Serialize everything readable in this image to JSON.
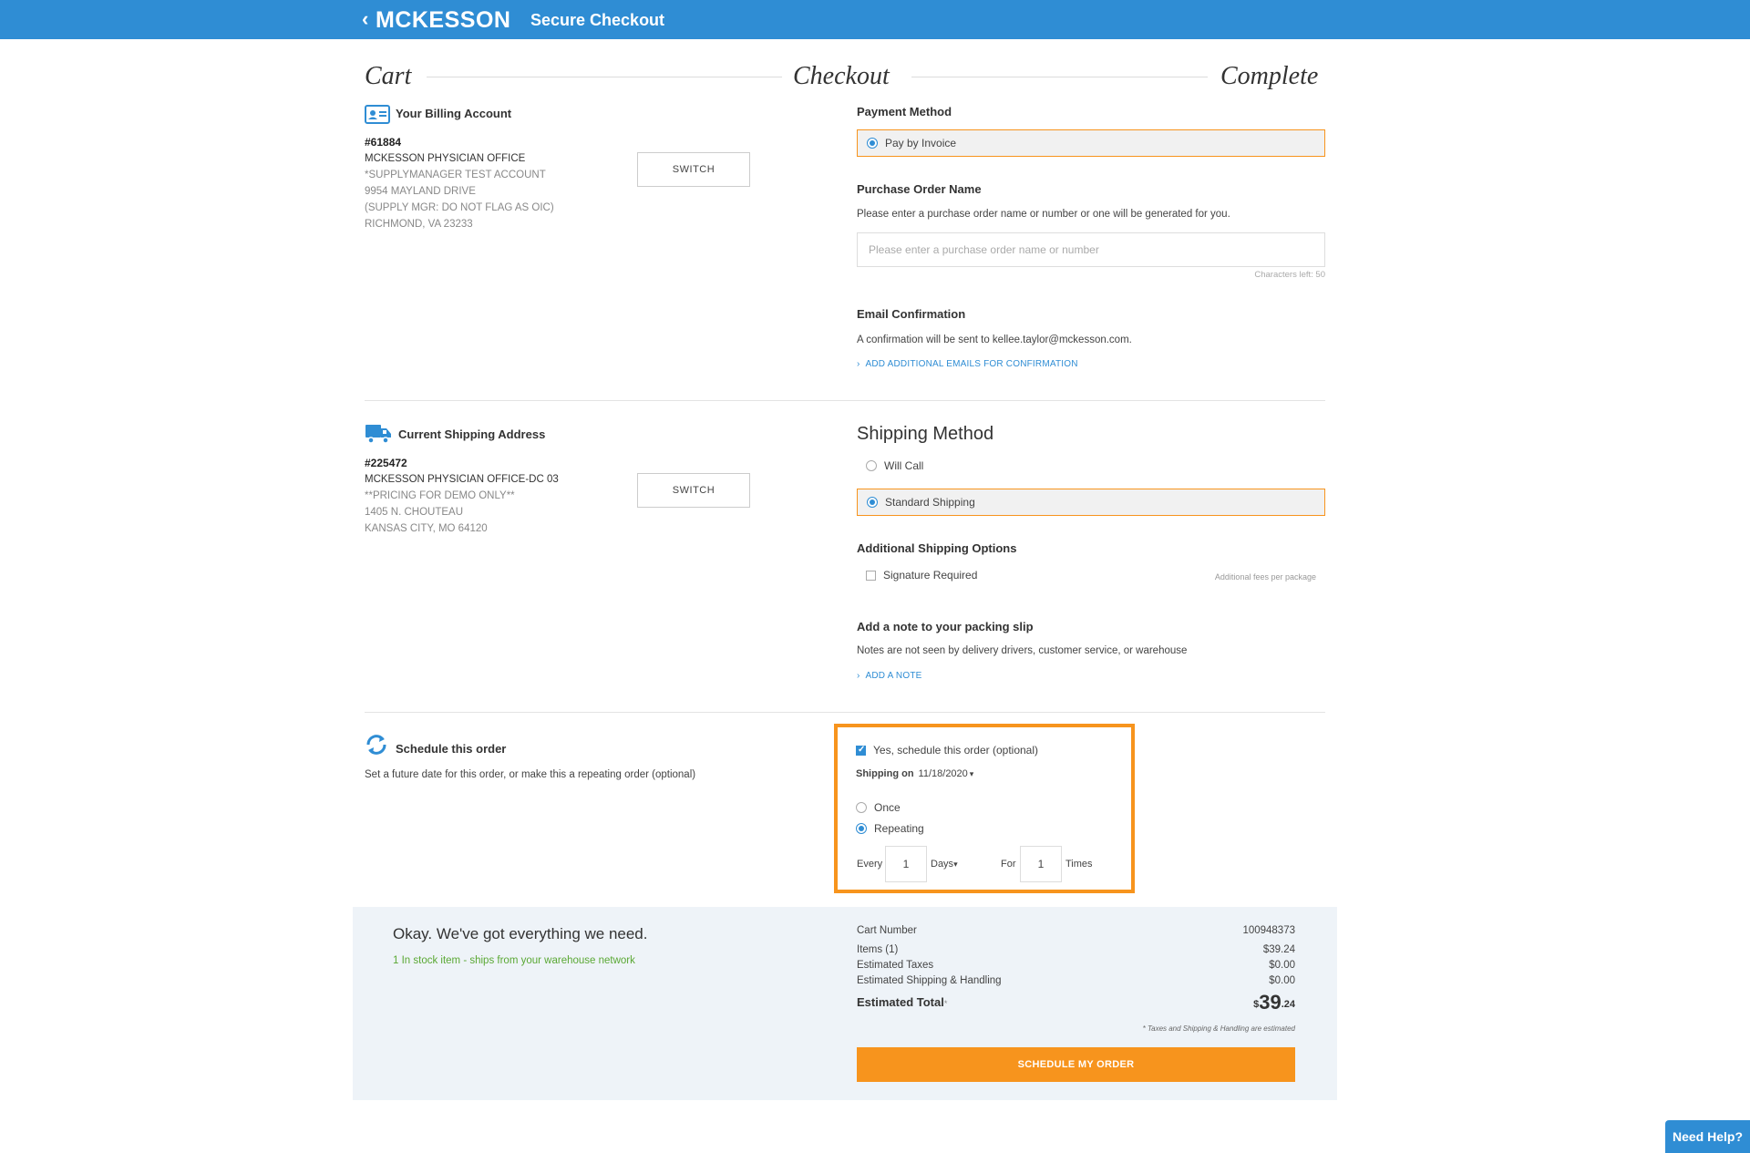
{
  "header": {
    "back_icon": "chevron-left-icon",
    "logo": "MCKESSON",
    "title": "Secure Checkout",
    "bg_color": "#2f8dd4"
  },
  "steps": {
    "cart": "Cart",
    "checkout": "Checkout",
    "complete": "Complete"
  },
  "billing": {
    "icon": "id-card-icon",
    "title": "Your Billing Account",
    "number": "#61884",
    "lines": [
      "MCKESSON PHYSICIAN OFFICE",
      "*SUPPLYMANAGER TEST ACCOUNT",
      "9954 MAYLAND DRIVE",
      "(SUPPLY MGR: DO NOT FLAG AS OIC)",
      "RICHMOND, VA 23233"
    ],
    "switch_label": "SWITCH"
  },
  "payment": {
    "title": "Payment Method",
    "selected_option": "Pay by Invoice"
  },
  "purchase_order": {
    "title": "Purchase Order Name",
    "help": "Please enter a purchase order name or number or one will be generated for you.",
    "placeholder": "Please enter a purchase order name or number",
    "value": "",
    "chars_left": "Characters left: 50"
  },
  "email": {
    "title": "Email Confirmation",
    "text": "A confirmation will be sent to kellee.taylor@mckesson.com.",
    "link": "ADD ADDITIONAL EMAILS FOR CONFIRMATION"
  },
  "shipping_address": {
    "icon": "truck-icon",
    "title": "Current Shipping Address",
    "number": "#225472",
    "lines": [
      "MCKESSON PHYSICIAN OFFICE-DC 03",
      "**PRICING FOR DEMO ONLY**",
      "1405 N. CHOUTEAU",
      "KANSAS CITY, MO 64120"
    ],
    "switch_label": "SWITCH"
  },
  "shipping_method": {
    "title": "Shipping Method",
    "options": [
      "Will Call",
      "Standard Shipping"
    ],
    "selected": "Standard Shipping"
  },
  "additional_shipping": {
    "title": "Additional Shipping Options",
    "signature_label": "Signature Required",
    "signature_checked": false,
    "fee_note": "Additional fees per package"
  },
  "packing_slip": {
    "title": "Add a note to your packing slip",
    "text": "Notes are not seen by delivery drivers, customer service, or warehouse",
    "link": "ADD A NOTE"
  },
  "schedule": {
    "icon": "refresh-icon",
    "title": "Schedule this order",
    "subtitle": "Set a future date for this order, or make this a repeating order (optional)",
    "yes_label": "Yes, schedule this order (optional)",
    "yes_checked": true,
    "shipping_on_label": "Shipping on",
    "shipping_on_value": "11/18/2020",
    "once_label": "Once",
    "repeating_label": "Repeating",
    "selected": "Repeating",
    "every_label": "Every",
    "every_value": "1",
    "unit_value": "Days",
    "for_label": "For",
    "for_value": "1",
    "times_label": "Times"
  },
  "summary": {
    "heading": "Okay. We've got everything we need.",
    "stock_note": "1 In stock item - ships from your warehouse network",
    "rows": [
      {
        "label": "Cart Number",
        "value": "100948373"
      },
      {
        "label": "Items (1)",
        "value": "$39.24"
      },
      {
        "label": "Estimated Taxes",
        "value": "$0.00"
      },
      {
        "label": "Estimated Shipping & Handling",
        "value": "$0.00"
      }
    ],
    "total_label": "Estimated Total",
    "total_marker": "*",
    "total_currency": "$",
    "total_dollars": "39",
    "total_cents": ".24",
    "footnote": "* Taxes and Shipping & Handling are estimated",
    "cta": "SCHEDULE MY ORDER"
  },
  "help": {
    "label": "Need Help?"
  },
  "colors": {
    "accent_blue": "#2f8dd4",
    "accent_orange": "#f7941d",
    "success_green": "#5aa834"
  }
}
